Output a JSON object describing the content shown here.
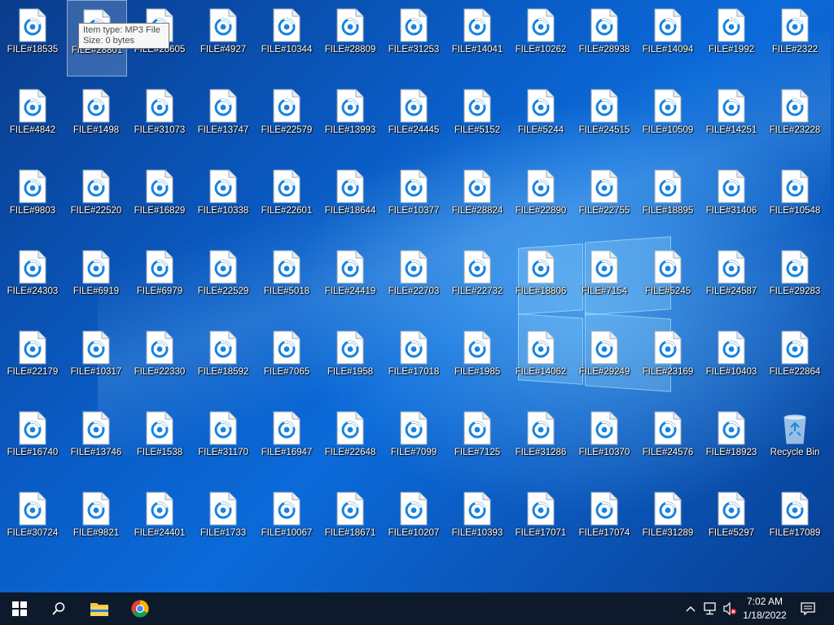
{
  "desktop": {
    "tooltip": {
      "line1": "Item type: MP3 File",
      "line2": "Size: 0 bytes"
    },
    "icons": [
      [
        "FILE#18535",
        "FILE#28801",
        "FILE#28605",
        "FILE#4927",
        "FILE#10344",
        "FILE#28809",
        "FILE#31253",
        "FILE#14041",
        "FILE#10262",
        "FILE#28938",
        "FILE#14094",
        "FILE#1992",
        "FILE#2322"
      ],
      [
        "FILE#4842",
        "FILE#1498",
        "FILE#31073",
        "FILE#13747",
        "FILE#22579",
        "FILE#13993",
        "FILE#24445",
        "FILE#5152",
        "FILE#5244",
        "FILE#24515",
        "FILE#10509",
        "FILE#14251",
        "FILE#23228"
      ],
      [
        "FILE#9803",
        "FILE#22520",
        "FILE#16829",
        "FILE#10338",
        "FILE#22601",
        "FILE#18644",
        "FILE#10377",
        "FILE#28824",
        "FILE#22890",
        "FILE#22755",
        "FILE#18895",
        "FILE#31406",
        "FILE#10548"
      ],
      [
        "FILE#24303",
        "FILE#6919",
        "FILE#6979",
        "FILE#22529",
        "FILE#5018",
        "FILE#24419",
        "FILE#22703",
        "FILE#22732",
        "FILE#18806",
        "FILE#7154",
        "FILE#5245",
        "FILE#24587",
        "FILE#29283"
      ],
      [
        "FILE#22179",
        "FILE#10317",
        "FILE#22330",
        "FILE#18592",
        "FILE#7065",
        "FILE#1958",
        "FILE#17018",
        "FILE#1985",
        "FILE#14062",
        "FILE#29249",
        "FILE#23169",
        "FILE#10403",
        "FILE#22864"
      ],
      [
        "FILE#16740",
        "FILE#13746",
        "FILE#1538",
        "FILE#31170",
        "FILE#16947",
        "FILE#22648",
        "FILE#7099",
        "FILE#7125",
        "FILE#31286",
        "FILE#10370",
        "FILE#24576",
        "FILE#18923",
        "Recycle Bin"
      ],
      [
        "FILE#30724",
        "FILE#9821",
        "FILE#24401",
        "FILE#1733",
        "FILE#10067",
        "FILE#18671",
        "FILE#10207",
        "FILE#10393",
        "FILE#17071",
        "FILE#17074",
        "FILE#31289",
        "FILE#5297",
        "FILE#17089"
      ]
    ]
  },
  "taskbar": {
    "clock_time": "7:02 AM",
    "clock_date": "1/18/2022",
    "apps": [
      "start-button",
      "search-button",
      "file-explorer",
      "chrome"
    ]
  },
  "colors": {
    "accent": "#1683e0",
    "taskbar": "#0d1a2b"
  }
}
